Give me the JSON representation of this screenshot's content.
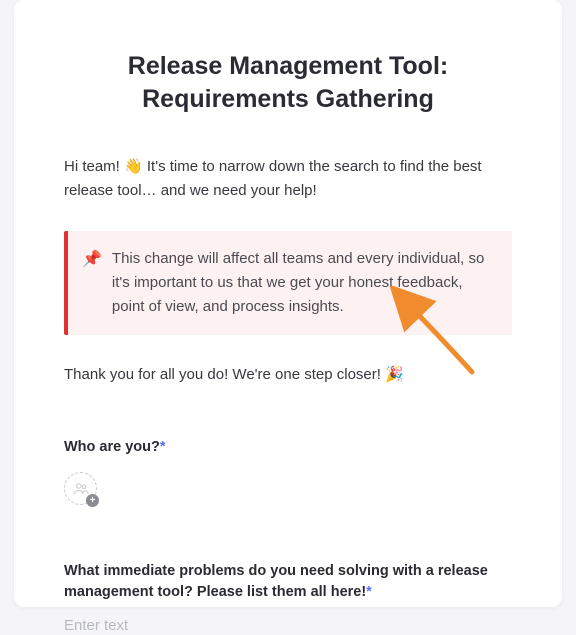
{
  "title": "Release Management Tool: Requirements Gathering",
  "intro_prefix": "Hi team! ",
  "intro_emoji": "👋",
  "intro_suffix": " It's time to narrow down the search to find the best release tool… and we need your help!",
  "callout": {
    "emoji": "📌",
    "text": "This change will affect all teams and every individual, so it's important to us that we get your honest feedback, point of view, and process insights."
  },
  "thanks_prefix": "Thank you for all you do! We're one step closer! ",
  "thanks_emoji": "🎉",
  "questions": {
    "q1": {
      "label": "Who are you?",
      "required_marker": "*"
    },
    "q2": {
      "label": "What immediate problems do you need solving with a release man­agement tool? Please list them all here!",
      "required_marker": "*",
      "placeholder": "Enter text"
    }
  },
  "colors": {
    "callout_bg": "#fdf1f1",
    "callout_border": "#e03131",
    "required": "#5b6ef5",
    "arrow": "#f08c2e"
  }
}
